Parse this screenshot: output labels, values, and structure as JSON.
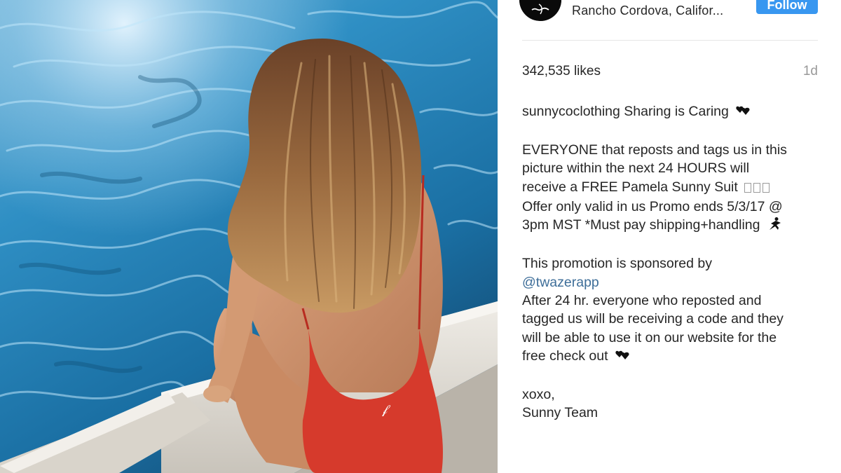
{
  "header": {
    "location": "Rancho Cordova, Califor...",
    "follow_label": "Follow"
  },
  "stats": {
    "likes": "342,535 likes",
    "time_ago": "1d"
  },
  "caption": {
    "username": "sunnycoclothing",
    "intro": "Sharing is Caring",
    "line1": "EVERYONE that reposts and tags us in this",
    "line2": "picture within the next 24 HOURS will",
    "line3": "receive a FREE Pamela Sunny Suit",
    "line4": "Offer only valid in us Promo ends 5/3/17 @",
    "line5": "3pm MST *Must pay shipping+handling",
    "line6": "This promotion is sponsored by",
    "mention": "@twazerapp",
    "line7": "After 24 hr. everyone who reposted and",
    "line8": "tagged us will be receiving a code and they",
    "line9": "will be able to use it on our website for the",
    "line10": "free check out",
    "signoff1": "xoxo,",
    "signoff2": "Sunny Team"
  },
  "icons": {
    "emoji1": "two-hearts-icon",
    "emoji2": "missing-glyph-boxes",
    "emoji3": "dancer-icon",
    "emoji4": "two-hearts-icon"
  },
  "colors": {
    "follow_button": "#3897f0",
    "mention": "#3e6e99",
    "muted": "#999999",
    "swimsuit": "#d63a2c",
    "pool_water": "#1d6f9c"
  }
}
